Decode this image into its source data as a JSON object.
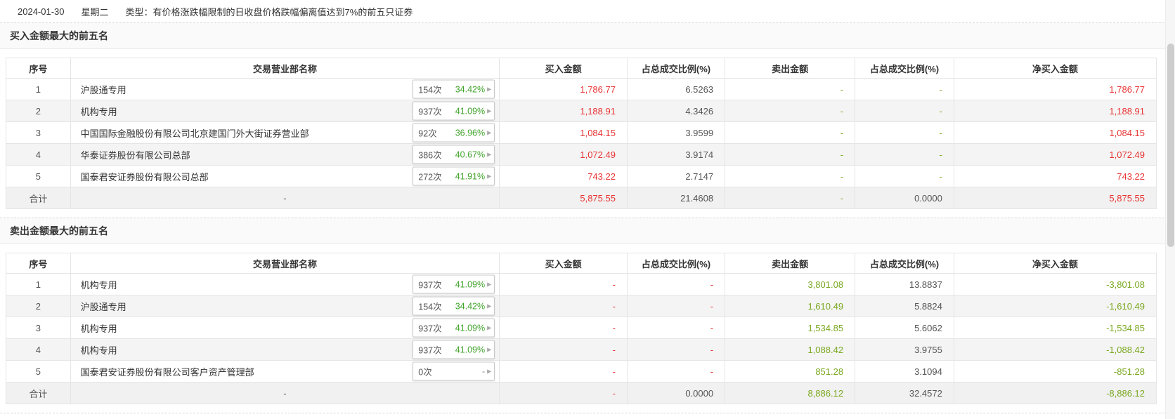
{
  "topbar": {
    "date": "2024-01-30",
    "weekday": "星期二",
    "type_label": "类型：",
    "type_text": "有价格涨跌幅限制的日收盘价格跌幅偏离值达到7%的前五只证券"
  },
  "colors": {
    "buy_red": "#e83333",
    "sell_green": "#7aa820",
    "badge_percent_green": "#3fa32a"
  },
  "buy": {
    "title": "买入金额最大的前五名",
    "columns": [
      "序号",
      "交易营业部名称",
      "买入金额",
      "占总成交比例(%)",
      "卖出金额",
      "占总成交比例(%)",
      "净买入金额"
    ],
    "rows": [
      {
        "no": "1",
        "name": "沪股通专用",
        "count": "154次",
        "pct": "34.42%",
        "buy": "1,786.77",
        "buy_ratio": "6.5263",
        "sell": "-",
        "sell_ratio": "-",
        "net": "1,786.77"
      },
      {
        "no": "2",
        "name": "机构专用",
        "count": "937次",
        "pct": "41.09%",
        "buy": "1,188.91",
        "buy_ratio": "4.3426",
        "sell": "-",
        "sell_ratio": "-",
        "net": "1,188.91"
      },
      {
        "no": "3",
        "name": "中国国际金融股份有限公司北京建国门外大街证券营业部",
        "count": "92次",
        "pct": "36.96%",
        "buy": "1,084.15",
        "buy_ratio": "3.9599",
        "sell": "-",
        "sell_ratio": "-",
        "net": "1,084.15"
      },
      {
        "no": "4",
        "name": "华泰证券股份有限公司总部",
        "count": "386次",
        "pct": "40.67%",
        "buy": "1,072.49",
        "buy_ratio": "3.9174",
        "sell": "-",
        "sell_ratio": "-",
        "net": "1,072.49"
      },
      {
        "no": "5",
        "name": "国泰君安证券股份有限公司总部",
        "count": "272次",
        "pct": "41.91%",
        "buy": "743.22",
        "buy_ratio": "2.7147",
        "sell": "-",
        "sell_ratio": "-",
        "net": "743.22"
      }
    ],
    "total": {
      "label": "合计",
      "name": "-",
      "buy": "5,875.55",
      "buy_ratio": "21.4608",
      "sell": "-",
      "sell_ratio": "0.0000",
      "net": "5,875.55"
    }
  },
  "sell": {
    "title": "卖出金额最大的前五名",
    "columns": [
      "序号",
      "交易营业部名称",
      "买入金额",
      "占总成交比例(%)",
      "卖出金额",
      "占总成交比例(%)",
      "净买入金额"
    ],
    "rows": [
      {
        "no": "1",
        "name": "机构专用",
        "count": "937次",
        "pct": "41.09%",
        "buy": "-",
        "buy_ratio": "-",
        "sell": "3,801.08",
        "sell_ratio": "13.8837",
        "net": "-3,801.08"
      },
      {
        "no": "2",
        "name": "沪股通专用",
        "count": "154次",
        "pct": "34.42%",
        "buy": "-",
        "buy_ratio": "-",
        "sell": "1,610.49",
        "sell_ratio": "5.8824",
        "net": "-1,610.49"
      },
      {
        "no": "3",
        "name": "机构专用",
        "count": "937次",
        "pct": "41.09%",
        "buy": "-",
        "buy_ratio": "-",
        "sell": "1,534.85",
        "sell_ratio": "5.6062",
        "net": "-1,534.85"
      },
      {
        "no": "4",
        "name": "机构专用",
        "count": "937次",
        "pct": "41.09%",
        "buy": "-",
        "buy_ratio": "-",
        "sell": "1,088.42",
        "sell_ratio": "3.9755",
        "net": "-1,088.42"
      },
      {
        "no": "5",
        "name": "国泰君安证券股份有限公司客户资产管理部",
        "count": "0次",
        "pct": "-",
        "buy": "-",
        "buy_ratio": "-",
        "sell": "851.28",
        "sell_ratio": "3.1094",
        "net": "-851.28"
      }
    ],
    "total": {
      "label": "合计",
      "name": "-",
      "buy": "-",
      "buy_ratio": "0.0000",
      "sell": "8,886.12",
      "sell_ratio": "32.4572",
      "net": "-8,886.12"
    }
  },
  "icons": {
    "badge_arrow": "▶"
  }
}
